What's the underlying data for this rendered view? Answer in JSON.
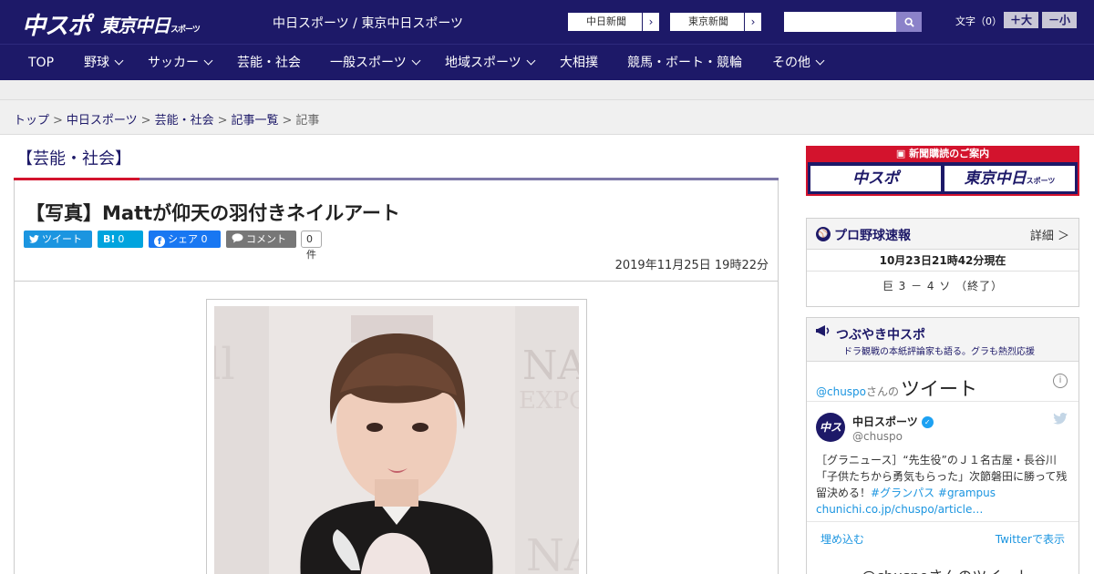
{
  "header": {
    "logo_main": "中スポ",
    "logo_tokyo": "東京中日",
    "logo_tokyo_small": "スポーツ",
    "site_name": "中日スポーツ / 東京中日スポーツ",
    "link_chunichi": "中日新聞",
    "link_tokyo": "東京新聞",
    "font_size_label": "文字（0）",
    "font_plus": "＋大",
    "font_minus": "－小"
  },
  "nav": {
    "items": [
      {
        "label": "TOP",
        "has_menu": false
      },
      {
        "label": "野球",
        "has_menu": true
      },
      {
        "label": "サッカー",
        "has_menu": true
      },
      {
        "label": "芸能・社会",
        "has_menu": false
      },
      {
        "label": "一般スポーツ",
        "has_menu": true
      },
      {
        "label": "地域スポーツ",
        "has_menu": true
      },
      {
        "label": "大相撲",
        "has_menu": false
      },
      {
        "label": "競馬・ボート・競輪",
        "has_menu": false
      },
      {
        "label": "その他",
        "has_menu": true
      }
    ]
  },
  "breadcrumb": {
    "items": [
      "トップ",
      "中日スポーツ",
      "芸能・社会",
      "記事一覧",
      "記事"
    ],
    "separator": ">"
  },
  "article": {
    "category": "【芸能・社会】",
    "headline": "【写真】Mattが仰天の羽付きネイルアート",
    "share": {
      "tweet": "ツイート",
      "hatena_icon": "B!",
      "hatena_count": "0",
      "facebook": "シェア",
      "facebook_count": "0",
      "comment": "コメント",
      "comment_count": "0件"
    },
    "date": "2019年11月25日 19時22分"
  },
  "sidebar": {
    "promo_title": "新聞購読のご案内",
    "promo_logo_1": "中スポ",
    "promo_logo_2": "東京中日",
    "promo_logo_2_small": "スポーツ",
    "baseball": {
      "title": "プロ野球速報",
      "more": "詳細 ＞",
      "time": "10月23日21時42分現在",
      "score": "巨 3 － 4 ソ （終了）"
    },
    "tweets": {
      "title": "つぶやき中スポ",
      "subtitle": "ドラ観戦の本紙評論家も語る。グラも熱烈応援",
      "handle": "@chuspo",
      "handle_suffix": "さんの",
      "handle_big": "ツイート",
      "account_name": "中日スポーツ",
      "account_screen": "@chuspo",
      "tweet_text_1": "［グラニュース］“先生役”のＪ１名古屋・長谷川「子供たちから勇気もらった」次節磐田に勝って残留決める！",
      "tweet_tags": "#グランパス #grampus",
      "tweet_link": "chunichi.co.jp/chuspo/article…",
      "embed": "埋め込む",
      "view_on_twitter": "Twitterで表示",
      "more_tweets": "@chuspoさんのツイート"
    }
  },
  "colors": {
    "brand_navy": "#1d1968",
    "accent_red": "#d3132d",
    "twitter_blue": "#1b95e0",
    "facebook_blue": "#1877f2",
    "hatena_blue": "#00a4de"
  }
}
